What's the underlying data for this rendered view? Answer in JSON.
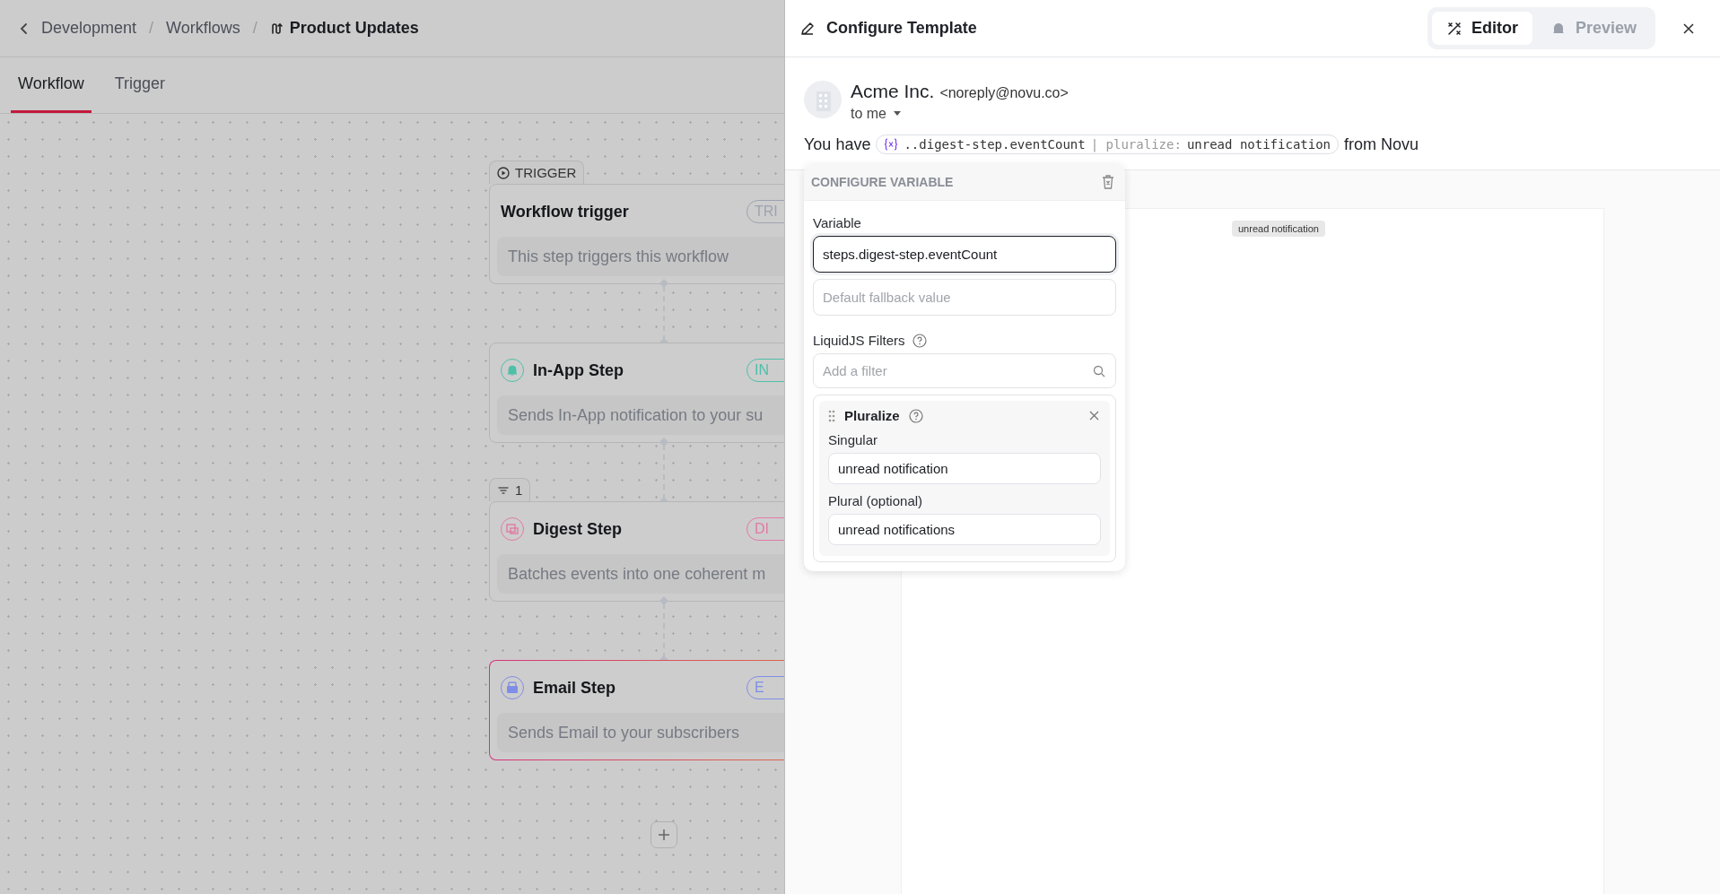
{
  "breadcrumb_separator": "/",
  "breadcrumbs": [
    {
      "label": "Development",
      "current": false
    },
    {
      "label": "Workflows",
      "current": false
    },
    {
      "label": "Product Updates",
      "current": true
    }
  ],
  "tabs": [
    {
      "label": "Workflow",
      "selected": true
    },
    {
      "label": "Trigger",
      "selected": false
    }
  ],
  "nodes": [
    {
      "kind": "trigger",
      "tag": "TRIGGER",
      "title": "Workflow trigger",
      "badge": "TRI",
      "description": "This step triggers this workflow",
      "color": "#9ca3af",
      "selected": false
    },
    {
      "kind": "in_app",
      "title": "In-App Step",
      "badge": "IN",
      "description": "Sends In-App notification to your su",
      "color": "#4fbfa8",
      "selected": false
    },
    {
      "kind": "digest",
      "tag": "1",
      "title": "Digest Step",
      "badge": "DI",
      "description": "Batches events into one coherent m",
      "color": "#e27aa3",
      "selected": false
    },
    {
      "kind": "email",
      "title": "Email Step",
      "badge": "E",
      "description": "Sends Email to your subscribers",
      "color": "#7f8ee6",
      "selected": true
    }
  ],
  "panel": {
    "title": "Configure Template",
    "modes": [
      {
        "label": "Editor",
        "selected": true
      },
      {
        "label": "Preview",
        "selected": false
      }
    ],
    "sender_name": "Acme Inc.",
    "sender_email": "<noreply@novu.co>",
    "recipient": "to me",
    "subject_start": "You have",
    "chip": {
      "variable": "..digest-step.eventCount",
      "filter": "| pluralize:",
      "argument": "unread notification"
    },
    "subject_end": "from Novu",
    "tooltip": "unread notification"
  },
  "popover": {
    "title": "CONFIGURE VARIABLE",
    "variable_label": "Variable",
    "variable_value": "steps.digest-step.eventCount",
    "fallback_placeholder": "Default fallback value",
    "filters_label": "LiquidJS Filters",
    "filter_search_placeholder": "Add a filter",
    "filters": [
      {
        "name": "Pluralize",
        "fields": [
          {
            "label": "Singular",
            "value": "unread notification"
          },
          {
            "label": "Plural (optional)",
            "value": "unread notifications"
          }
        ]
      }
    ]
  }
}
